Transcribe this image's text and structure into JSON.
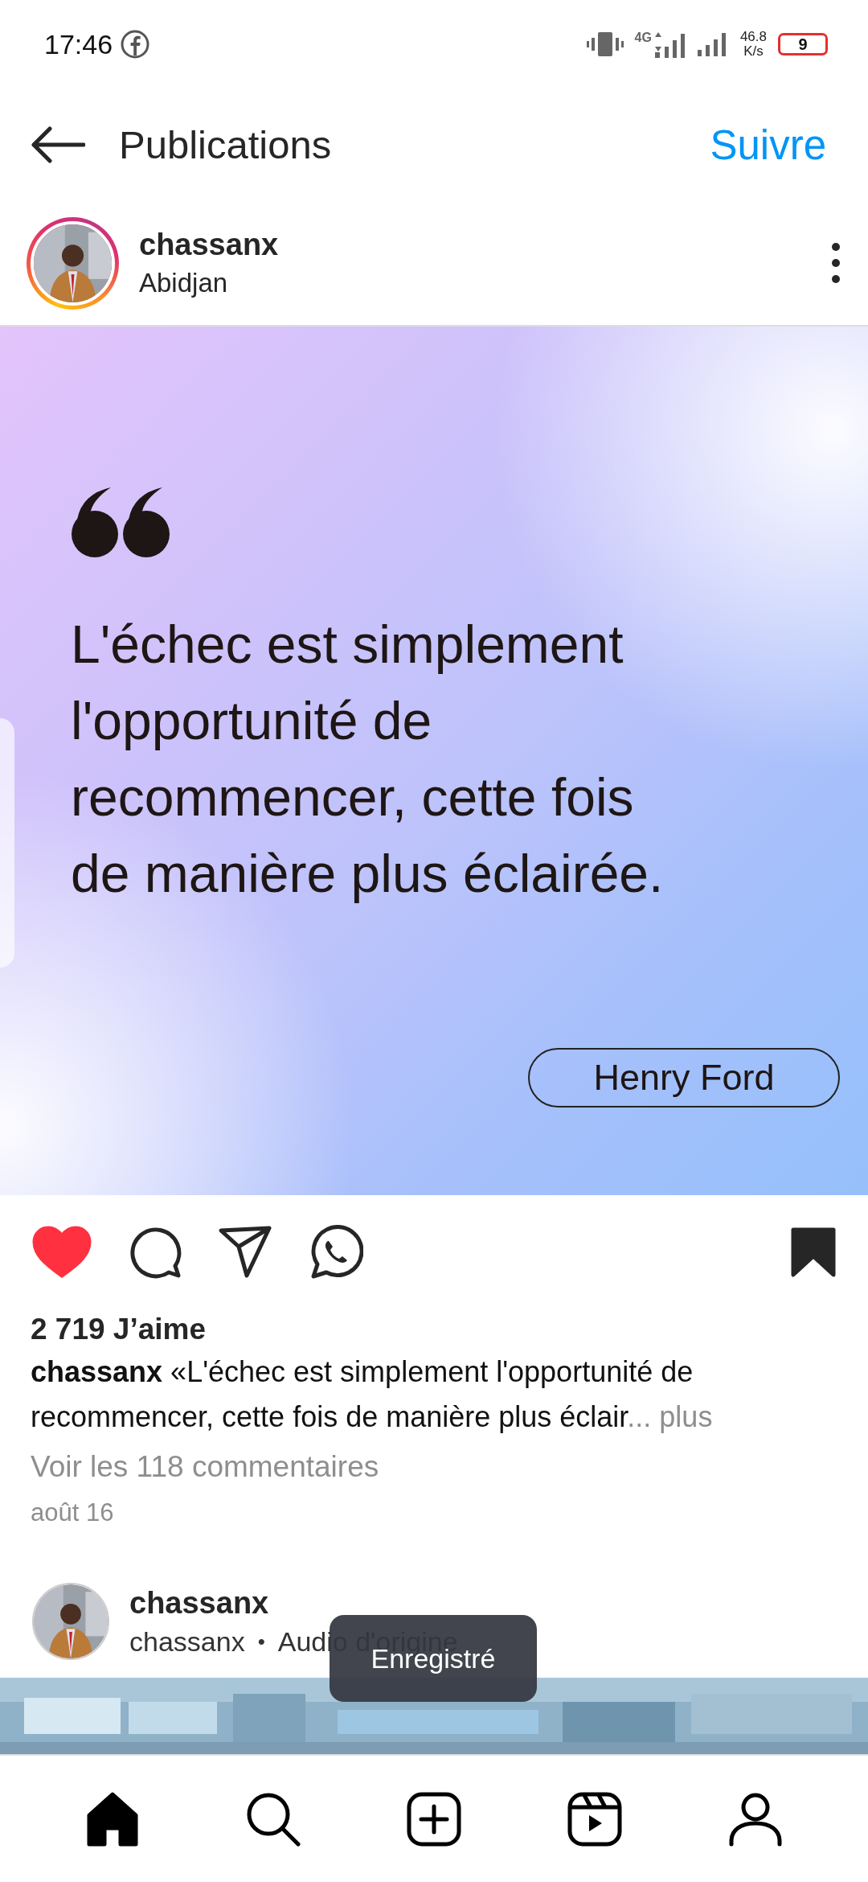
{
  "status_bar": {
    "time": "17:46",
    "network": "4G",
    "net_speed": [
      "46.8",
      "K/s"
    ],
    "battery": "9"
  },
  "header": {
    "title": "Publications",
    "follow": "Suivre"
  },
  "post": {
    "username": "chassanx",
    "location": "Abidjan",
    "image": {
      "quote": "L'échec est simplement l'opportunité de recommencer, cette fois de manière plus éclairée.",
      "author": "Henry Ford"
    },
    "liked": true,
    "saved": true,
    "likes": "2 719 J’aime",
    "caption": {
      "username": "chassanx",
      "text": "«L'échec est simplement l'opportunité de recommencer, cette fois de manière plus éclair",
      "more": "... plus"
    },
    "comments_link": "Voir les 118 commentaires",
    "date": "août 16"
  },
  "next_post": {
    "username": "chassanx",
    "subtitle_user": "chassanx",
    "separator": "•",
    "audio": "Audio d'origine"
  },
  "toast": "Enregistré",
  "nav": [
    {
      "kind": "home",
      "selected": true
    },
    {
      "kind": "search",
      "selected": false
    },
    {
      "kind": "create",
      "selected": false
    },
    {
      "kind": "reels",
      "selected": false
    },
    {
      "kind": "profile",
      "selected": false
    }
  ]
}
